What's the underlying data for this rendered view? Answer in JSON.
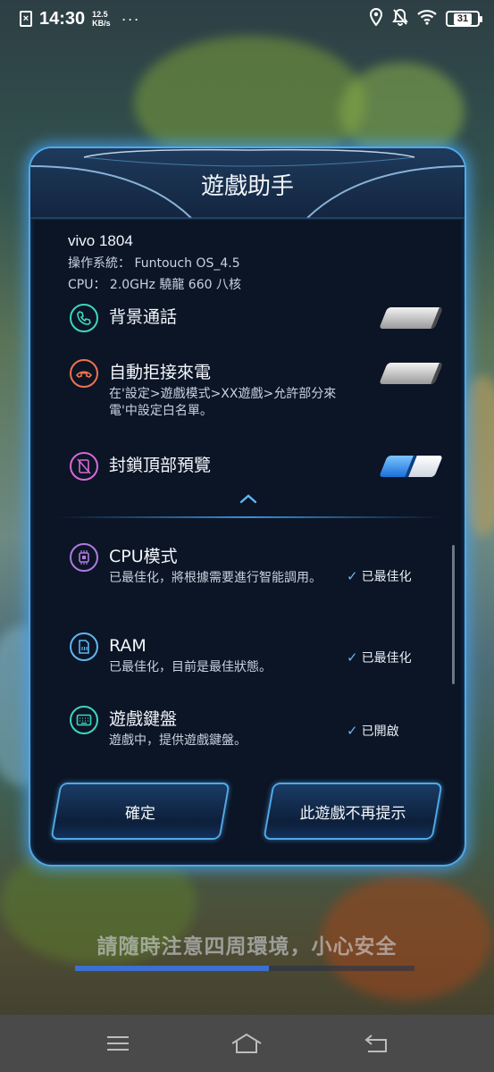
{
  "status_bar": {
    "sim_label": "×",
    "time": "14:30",
    "net_speed_value": "12.5",
    "net_speed_unit": "KB/s",
    "more": "···",
    "battery": "31"
  },
  "dialog": {
    "title": "遊戲助手",
    "device": {
      "model": "vivo 1804",
      "os_line": "操作系統： Funtouch OS_4.5",
      "cpu_line": "CPU： 2.0GHz 驍龍 660 八核"
    },
    "toggles": [
      {
        "icon": "phone-icon",
        "title": "背景通話",
        "subtitle": "",
        "state": "off"
      },
      {
        "icon": "hangup-icon",
        "title": "自動拒接來電",
        "subtitle": "在'設定>遊戲模式>XX遊戲>允許部分來電'中設定白名單。",
        "state": "off"
      },
      {
        "icon": "block-notification-icon",
        "title": "封鎖頂部預覽",
        "subtitle": "",
        "state": "on"
      }
    ],
    "optimizations": [
      {
        "icon": "cpu-icon",
        "title": "CPU模式",
        "subtitle": "已最佳化，將根據需要進行智能調用。",
        "status": "已最佳化"
      },
      {
        "icon": "ram-icon",
        "title": "RAM",
        "subtitle": "已最佳化，目前是最佳狀態。",
        "status": "已最佳化"
      },
      {
        "icon": "keyboard-icon",
        "title": "遊戲鍵盤",
        "subtitle": "遊戲中，提供遊戲鍵盤。",
        "status": "已開啟"
      }
    ],
    "buttons": {
      "confirm": "確定",
      "dont_remind": "此遊戲不再提示"
    }
  },
  "safety_notice": "請隨時注意四周環境，小心安全",
  "loading_progress": 0.57,
  "colors": {
    "accent": "#4fa9e8",
    "dialog_bg": "#0b1526",
    "phone_ring": "#3fd6c0",
    "hangup_ring": "#f0724e",
    "block_ring": "#d76ad8",
    "cpu_ring": "#b07ae0",
    "ram_ring": "#5fb6f2",
    "keyboard_ring": "#3fd6c0"
  }
}
